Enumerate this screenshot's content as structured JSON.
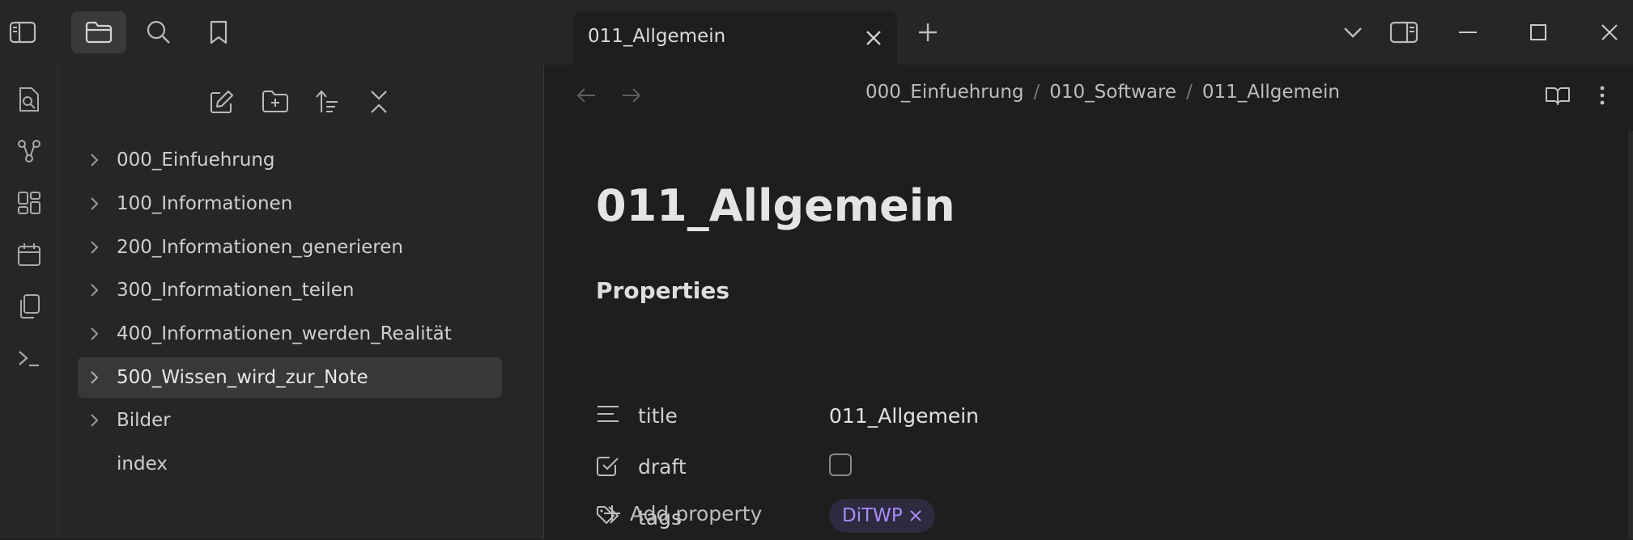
{
  "colors": {
    "background": "#1e1e1e",
    "sidebar": "#262626",
    "accent": "#a88bfa",
    "tag_bg": "#2e2a3f",
    "text": "#dadada"
  },
  "topbar": {
    "icons": [
      "sidebar-toggle-icon",
      "folder-icon",
      "search-icon",
      "bookmark-icon"
    ],
    "tab": {
      "title": "011_Allgemein"
    },
    "right_icons": [
      "chevron-down-icon",
      "right-sidebar-icon",
      "minimize-icon",
      "maximize-icon",
      "close-icon"
    ]
  },
  "ribbon": {
    "icons": [
      "quick-switcher-icon",
      "graph-view-icon",
      "canvas-icon",
      "daily-note-icon",
      "templates-icon",
      "command-palette-icon"
    ]
  },
  "explorer": {
    "tools": [
      "new-note-icon",
      "new-folder-icon",
      "sort-icon",
      "collapse-all-icon"
    ],
    "items": [
      {
        "label": "000_Einfuehrung",
        "type": "folder",
        "active": false
      },
      {
        "label": "100_Informationen",
        "type": "folder",
        "active": false
      },
      {
        "label": "200_Informationen_generieren",
        "type": "folder",
        "active": false
      },
      {
        "label": "300_Informationen_teilen",
        "type": "folder",
        "active": false
      },
      {
        "label": "400_Informationen_werden_Realität",
        "type": "folder",
        "active": false
      },
      {
        "label": "500_Wissen_wird_zur_Note",
        "type": "folder",
        "active": true
      },
      {
        "label": "Bilder",
        "type": "folder",
        "active": false
      },
      {
        "label": "index",
        "type": "file",
        "active": false
      }
    ]
  },
  "main": {
    "breadcrumb": [
      "000_Einfuehrung",
      "010_Software",
      "011_Allgemein"
    ],
    "breadcrumb_separator": "/",
    "note_title": "011_Allgemein",
    "properties_heading": "Properties",
    "properties": {
      "title": {
        "key": "title",
        "value": "011_Allgemein"
      },
      "draft": {
        "key": "draft",
        "checked": false
      },
      "tags": {
        "key": "tags",
        "tag": "DiTWP"
      }
    },
    "add_property_label": "Add property"
  }
}
